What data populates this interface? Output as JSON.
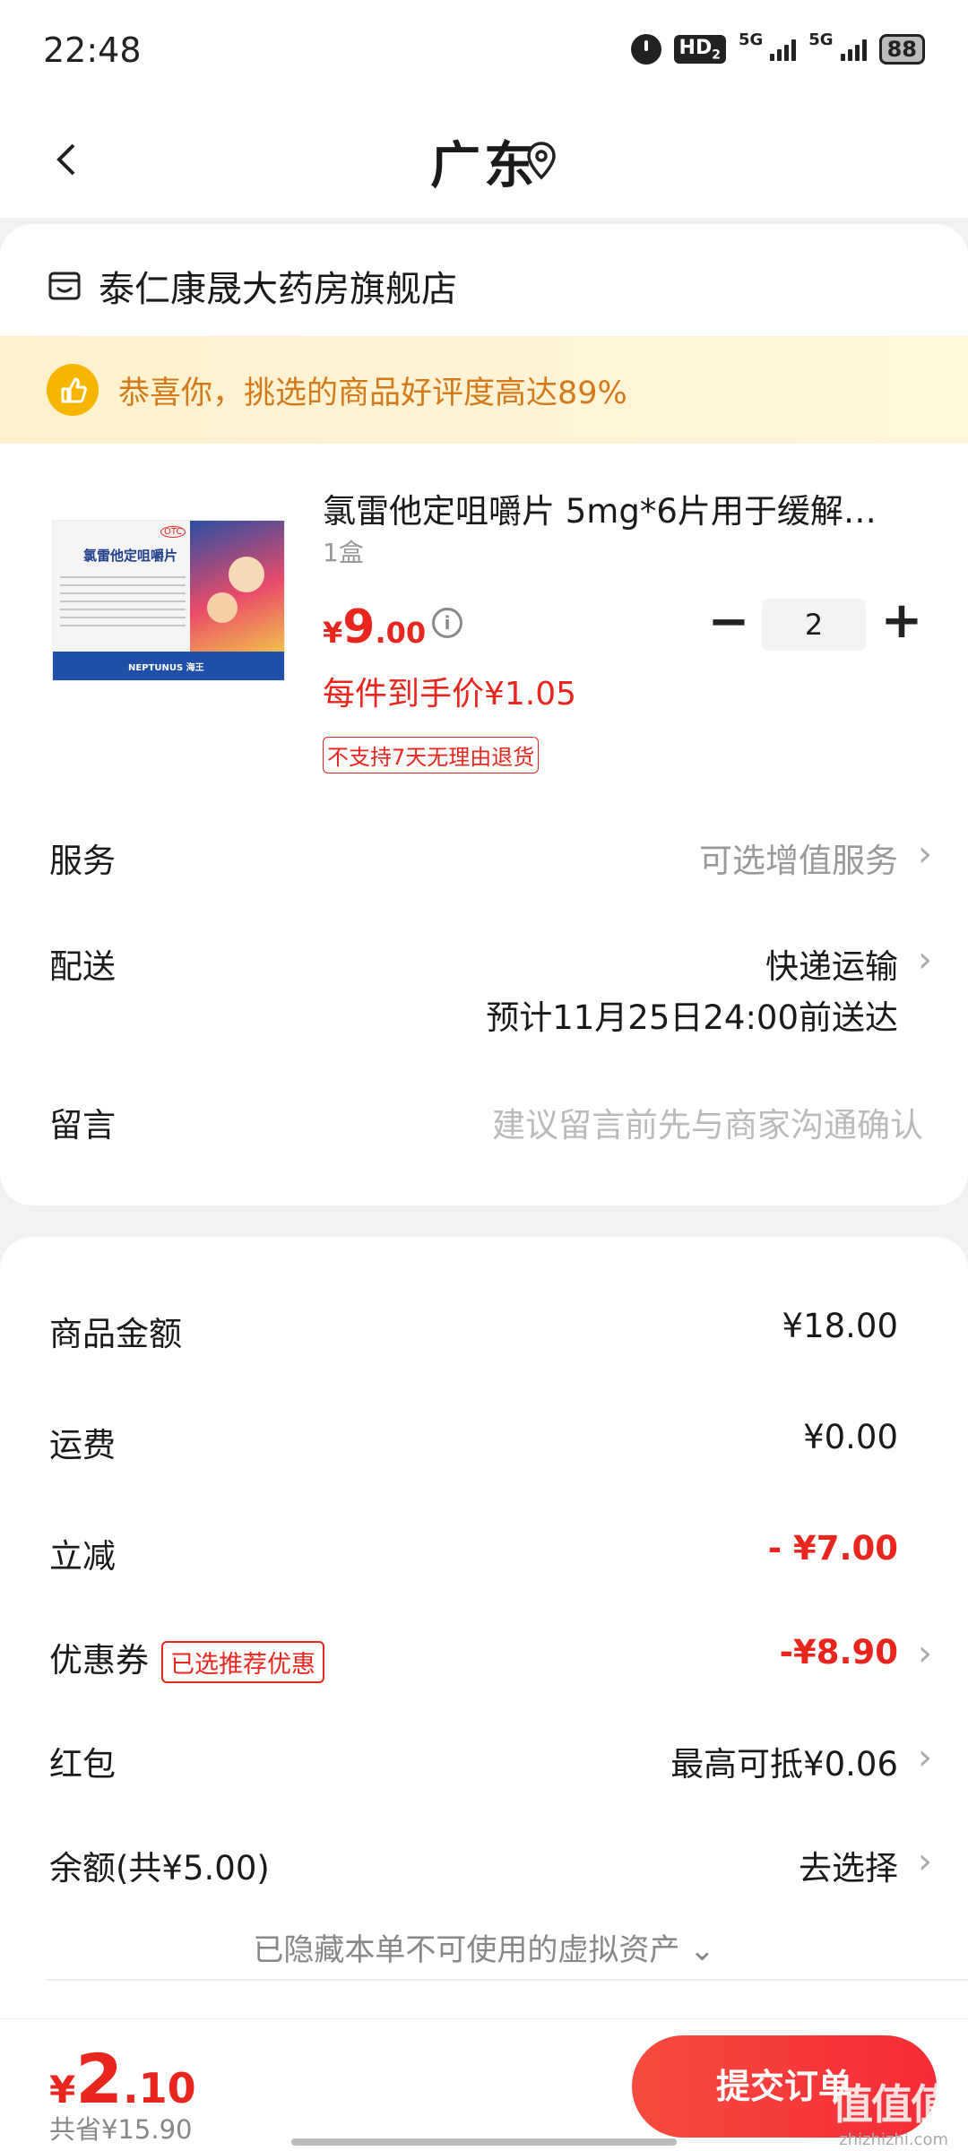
{
  "status_bar": {
    "time": "22:48",
    "hd": "HD",
    "hd_sub": "2",
    "net1": "5G",
    "net2": "5G",
    "battery": "88"
  },
  "header": {
    "title": "广东"
  },
  "store": {
    "name": "泰仁康晟大药房旗舰店"
  },
  "praise": {
    "text": "恭喜你，挑选的商品好评度高达89%"
  },
  "product": {
    "title": "氯雷他定咀嚼片 5mg*6片用于缓解…",
    "spec": "1盒",
    "price_currency": "¥",
    "price_int": "9",
    "price_dec": ".00",
    "quantity": "2",
    "unit_price": "每件到手价¥1.05",
    "return_policy": "不支持7天无理由退货",
    "box_label": "氯雷他定咀嚼片",
    "box_badge": "OTC",
    "box_brand": "NEPTUNUS 海王"
  },
  "order_rows": {
    "service_label": "服务",
    "service_value": "可选增值服务",
    "delivery_label": "配送",
    "delivery_value": "快递运输",
    "delivery_eta": "预计11月25日24:00前送达",
    "message_label": "留言",
    "message_placeholder": "建议留言前先与商家沟通确认"
  },
  "summary": {
    "goods_label": "商品金额",
    "goods_value": "¥18.00",
    "shipping_label": "运费",
    "shipping_value": "¥0.00",
    "discount_label": "立减",
    "discount_value": "- ¥7.00",
    "coupon_label": "优惠券",
    "coupon_tag": "已选推荐优惠",
    "coupon_value": "-¥8.90",
    "redpacket_label": "红包",
    "redpacket_value": "最高可抵¥0.06",
    "balance_label": "余额(共¥5.00)",
    "balance_value": "去选择",
    "hidden_assets": "已隐藏本单不可使用的虚拟资产 ⌄"
  },
  "bottom": {
    "total_currency": "¥",
    "total_int": "2",
    "total_dec": ".10",
    "saved": "共省¥15.90",
    "submit": "提交订单",
    "watermark": "值值值",
    "watermark_sub": "zhizhizhi.com"
  },
  "colors": {
    "accent": "#e8261d",
    "praise_text": "#d47a1c",
    "praise_bg": "#fdf1cc"
  }
}
